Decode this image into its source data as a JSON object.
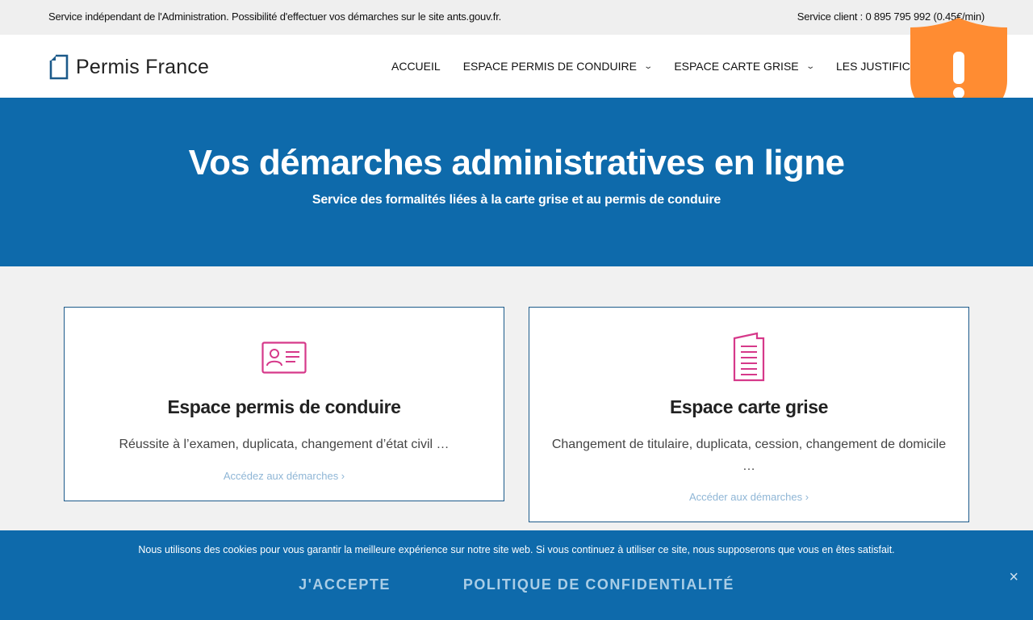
{
  "topbar": {
    "notice": "Service indépendant de l'Administration. Possibilité d'effectuer vos démarches sur le site ants.gouv.fr.",
    "service_client": "Service client : 0 895 795 992 (0.45€/min)"
  },
  "header": {
    "logo_text": "Permis France",
    "nav": [
      {
        "label": "ACCUEIL"
      },
      {
        "label": "ESPACE PERMIS DE CONDUIRE"
      },
      {
        "label": "ESPACE CARTE GRISE"
      },
      {
        "label": "LES JUSTIFICATIFS"
      }
    ]
  },
  "hero": {
    "title": "Vos démarches administratives en ligne",
    "subtitle": "Service des formalités liées à la carte grise et au permis de conduire"
  },
  "cards": [
    {
      "title": "Espace permis de conduire",
      "description": "Réussite à l’examen, duplicata, changement d’état civil …",
      "cta": "Accédez aux démarches ›"
    },
    {
      "title": "Espace carte grise",
      "description": "Changement de titulaire, duplicata, cession, changement de domicile …",
      "cta": "Accéder aux démarches ›"
    }
  ],
  "cookie": {
    "message": "Nous utilisons des cookies pour vous garantir la meilleure expérience sur notre site web. Si vous continuez à utiliser ce site, nous supposerons que vous en êtes satisfait.",
    "accept": "J'ACCEPTE",
    "privacy": "POLITIQUE DE CONFIDENTIALITÉ",
    "close": "×"
  },
  "colors": {
    "brand_blue": "#0e6aab",
    "icon_pink": "#d6398a",
    "shield_orange": "#ff8c32"
  },
  "icons": {
    "logo": "document-outline-icon",
    "card1": "id-card-icon",
    "card2": "document-list-icon",
    "shield": "warning-shield-icon"
  }
}
